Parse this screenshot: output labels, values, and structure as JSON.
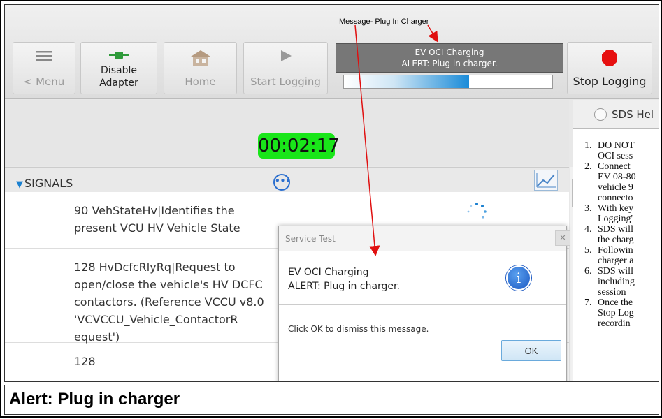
{
  "annotation": {
    "label": "Message- Plug In Charger"
  },
  "toolbar": {
    "menu_label": "< Menu",
    "disable_line1": "Disable",
    "disable_line2": "Adapter",
    "home_label": "Home",
    "start_label": "Start Logging",
    "stop_label": "Stop Logging"
  },
  "status": {
    "line1": "EV OCI Charging",
    "line2": "ALERT: Plug in charger.",
    "progress": 0.6
  },
  "timer": "00:02:17",
  "signals": {
    "title": "SIGNALS",
    "rows": [
      {
        "text": "90 VehStateHv|Identifies the present VCU HV Vehicle State"
      },
      {
        "text": "128 HvDcfcRlyRq|Request to open/close the vehicle's HV DCFC contactors. (Reference VCCU v8.0 'VCVCCU_Vehicle_ContactorR equest')"
      },
      {
        "text": "128"
      }
    ]
  },
  "right_panel": {
    "tab_label": "SDS Hel",
    "items": [
      {
        "n": "1.",
        "l1": "DO NOT",
        "l2": "OCI sess"
      },
      {
        "n": "2.",
        "l1": "Connect",
        "l2": "EV 08-80",
        "l3": "vehicle 9",
        "l4": "connecto"
      },
      {
        "n": "3.",
        "l1": "With key",
        "l2": "Logging'"
      },
      {
        "n": "4.",
        "l1": "SDS will",
        "l2": "the charg"
      },
      {
        "n": "5.",
        "l1": "Followin",
        "l2": "charger a"
      },
      {
        "n": "6.",
        "l1": "SDS will",
        "l2": "including",
        "l3": "session"
      },
      {
        "n": "7.",
        "l1": "Once the",
        "l2": "Stop Log",
        "l3": "recordin"
      }
    ]
  },
  "dialog": {
    "title": "Service Test",
    "msg1": "EV OCI Charging",
    "msg2": "ALERT: Plug in charger.",
    "dismiss": "Click OK to dismiss this message.",
    "ok": "OK"
  },
  "caption": "Alert: Plug in charger",
  "colors": {
    "timer_bg": "#19e619",
    "arrow": "#e01010",
    "stop_icon": "#e61010",
    "info_icon": "#1b58c2"
  }
}
